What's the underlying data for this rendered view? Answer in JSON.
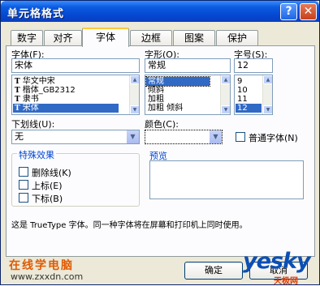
{
  "window": {
    "title": "单元格格式",
    "help_glyph": "?",
    "close_glyph": "✕"
  },
  "tabs": [
    "数字",
    "对齐",
    "字体",
    "边框",
    "图案",
    "保护"
  ],
  "active_tab": "字体",
  "font": {
    "label": "字体(F):",
    "value": "宋体",
    "list": [
      "华文中宋",
      "楷体_GB2312",
      "隶书",
      "宋体"
    ],
    "selected": "宋体",
    "tt_glyph": "T"
  },
  "style": {
    "label": "字形(O):",
    "value": "常规",
    "list": [
      "常规",
      "倾斜",
      "加粗",
      "加粗 倾斜"
    ],
    "selected": "常规"
  },
  "size": {
    "label": "字号(S):",
    "value": "12",
    "list": [
      "9",
      "10",
      "11",
      "12"
    ],
    "selected": "12"
  },
  "underline": {
    "label": "下划线(U):",
    "value": "无"
  },
  "color": {
    "label": "颜色(C):",
    "value": ""
  },
  "normal_font": {
    "label": "普通字体(N)",
    "checked": false
  },
  "effects": {
    "title": "特殊效果",
    "items": [
      {
        "label": "删除线(K)",
        "checked": false
      },
      {
        "label": "上标(E)",
        "checked": false
      },
      {
        "label": "下标(B)",
        "checked": false
      }
    ]
  },
  "preview": {
    "title": "预览"
  },
  "info_text": "这是 TrueType 字体。同一种字体将在屏幕和打印机上同时使用。",
  "buttons": {
    "ok": "确定",
    "cancel": "取消"
  },
  "watermark": {
    "line1": "在线学电脑",
    "line2": "www.zxxdn.com",
    "logo": "yesky",
    "logo_sub": "天极网"
  },
  "colors": {
    "title_bar": "#0b5be0",
    "selection": "#316ac5",
    "group_title": "#0046d5"
  }
}
